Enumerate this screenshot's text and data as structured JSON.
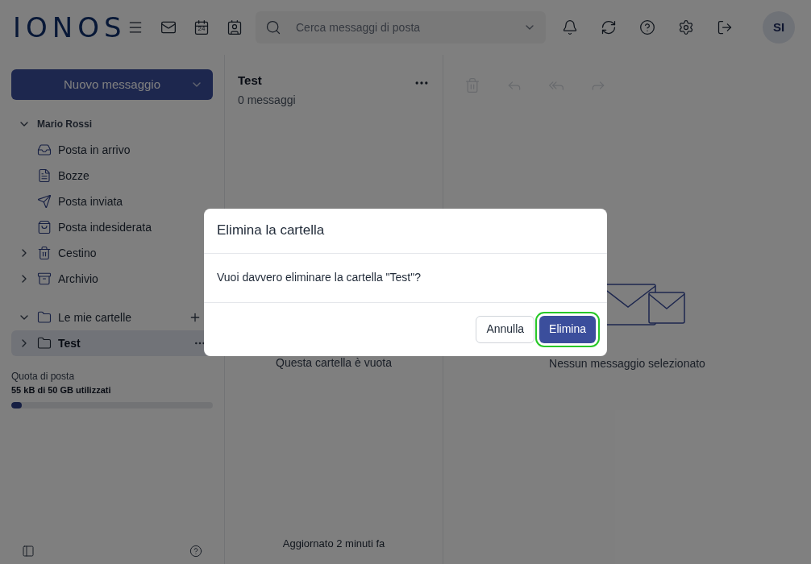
{
  "header": {
    "logo": "IONOS",
    "calendar_day": "24",
    "search": {
      "placeholder": "Cerca messaggi di posta"
    },
    "avatar": "SI"
  },
  "sidebar": {
    "new_button": "Nuovo messaggio",
    "folders": [
      {
        "label": "Mario Rossi",
        "kind": "account",
        "expanded": true,
        "selected": false,
        "children": [
          {
            "label": "Posta in arrivo",
            "kind": "inbox",
            "selected": false
          },
          {
            "label": "Bozze",
            "kind": "drafts",
            "selected": false
          },
          {
            "label": "Posta inviata",
            "kind": "sent",
            "selected": false
          },
          {
            "label": "Posta indesiderata",
            "kind": "spam",
            "selected": false
          },
          {
            "label": "Cestino",
            "kind": "trash",
            "expanded": false,
            "selected": false
          },
          {
            "label": "Archivio",
            "kind": "archive",
            "expanded": false,
            "selected": false
          }
        ]
      },
      {
        "label": "Le mie cartelle",
        "kind": "group",
        "expanded": true,
        "selected": false,
        "children": [
          {
            "label": "Test",
            "kind": "folder",
            "expanded": false,
            "selected": true
          }
        ]
      }
    ],
    "quota": {
      "label": "Quota di posta",
      "usage": "55 kB di 50 GB utilizzati",
      "level": 0.05
    }
  },
  "message_list": {
    "title": "Test",
    "count": "0 messaggi",
    "empty": "Questa cartella è vuota",
    "updated": "Aggiornato 2 minuti fa"
  },
  "reading_pane": {
    "empty": "Nessun messaggio selezionato"
  },
  "dialog": {
    "title": "Elimina la cartella",
    "message": "Vuoi davvero eliminare la cartella \"Test\"?",
    "buttons": [
      {
        "label": "Annulla",
        "kind": "secondary",
        "highlighted": false
      },
      {
        "label": "Elimina",
        "kind": "primary",
        "highlighted": true
      }
    ]
  }
}
